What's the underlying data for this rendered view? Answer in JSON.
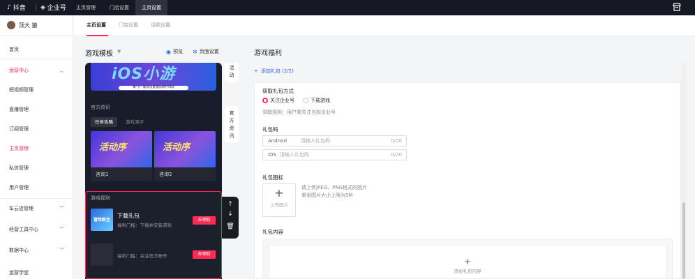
{
  "topbar": {
    "brand": "抖音",
    "brand2": "企业号",
    "tabs": [
      "主页管理",
      "门店设置",
      "主页设置"
    ],
    "icon": "shop-icon"
  },
  "sidebar": {
    "user": "顶大 猿",
    "items": [
      {
        "label": "首页",
        "type": "plain"
      },
      {
        "label": "运营中心",
        "type": "group-open"
      },
      {
        "label": "短视频管理",
        "type": "sub"
      },
      {
        "label": "直播管理",
        "type": "sub"
      },
      {
        "label": "订阅管理",
        "type": "sub"
      },
      {
        "label": "主页管理",
        "type": "sub-active"
      },
      {
        "label": "私信管理",
        "type": "sub"
      },
      {
        "label": "用户管理",
        "type": "sub"
      },
      {
        "label": "车云店管理",
        "type": "group"
      },
      {
        "label": "经营工具中心",
        "type": "group"
      },
      {
        "label": "数据中心",
        "type": "group"
      },
      {
        "label": "运营学堂",
        "type": "plain"
      }
    ]
  },
  "subtabs": [
    "主页设置",
    "门店设置",
    "话题设置"
  ],
  "template": {
    "title": "游戏模板",
    "preview": "预览",
    "page_settings": "页面设置"
  },
  "phone": {
    "banner_text": "iOS小游",
    "banner_strip": "乘\"分\" 破浪流量激励限时领取",
    "official_label": "官方资讯",
    "chips": [
      "任务攻略",
      "游戏测评"
    ],
    "card_text": "活动序",
    "cards": [
      "咨询1",
      "咨询2"
    ],
    "welfare_label": "游戏福利",
    "gifts": [
      {
        "title": "下载礼包",
        "sub": "福利门槛：下载并安装游戏",
        "btn": "去领取",
        "thumb": "冒险新生"
      },
      {
        "title": "",
        "sub": "福利门槛：关注官方账号",
        "btn": "去领取",
        "thumb": ""
      }
    ],
    "side_bubbles": [
      "活动",
      "官方资讯"
    ]
  },
  "right": {
    "title": "游戏福利",
    "add_gift": "添加礼包 (2/2)",
    "get_method_label": "获取礼包方式",
    "radio_options": [
      "关注企业号",
      "下载游戏"
    ],
    "radio_selected": 0,
    "rule": "领取规则：用户需关注当前企业号",
    "code_label": "礼包码",
    "inputs": [
      {
        "key": "Android",
        "placeholder": "请输入礼包码",
        "count": "0/20"
      },
      {
        "key": "iOS",
        "placeholder": "请输入礼包码",
        "count": "0/20"
      }
    ],
    "icon_label": "礼包图标",
    "upload_label": "上传图片",
    "upload_hint1": "请上传JPEG、PNG格式的图片",
    "upload_hint2": "单张图片大小上限为5M",
    "content_label": "礼包内容",
    "add_content": "添加礼包内容"
  }
}
